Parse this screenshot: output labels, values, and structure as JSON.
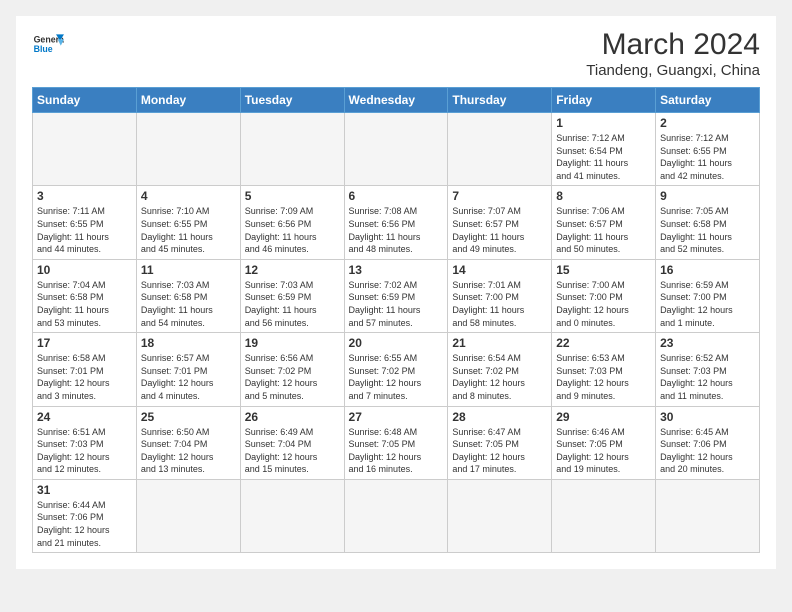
{
  "header": {
    "logo_general": "General",
    "logo_blue": "Blue",
    "month_year": "March 2024",
    "location": "Tiandeng, Guangxi, China"
  },
  "days_of_week": [
    "Sunday",
    "Monday",
    "Tuesday",
    "Wednesday",
    "Thursday",
    "Friday",
    "Saturday"
  ],
  "weeks": [
    [
      {
        "day": "",
        "info": ""
      },
      {
        "day": "",
        "info": ""
      },
      {
        "day": "",
        "info": ""
      },
      {
        "day": "",
        "info": ""
      },
      {
        "day": "",
        "info": ""
      },
      {
        "day": "1",
        "info": "Sunrise: 7:12 AM\nSunset: 6:54 PM\nDaylight: 11 hours\nand 41 minutes."
      },
      {
        "day": "2",
        "info": "Sunrise: 7:12 AM\nSunset: 6:55 PM\nDaylight: 11 hours\nand 42 minutes."
      }
    ],
    [
      {
        "day": "3",
        "info": "Sunrise: 7:11 AM\nSunset: 6:55 PM\nDaylight: 11 hours\nand 44 minutes."
      },
      {
        "day": "4",
        "info": "Sunrise: 7:10 AM\nSunset: 6:55 PM\nDaylight: 11 hours\nand 45 minutes."
      },
      {
        "day": "5",
        "info": "Sunrise: 7:09 AM\nSunset: 6:56 PM\nDaylight: 11 hours\nand 46 minutes."
      },
      {
        "day": "6",
        "info": "Sunrise: 7:08 AM\nSunset: 6:56 PM\nDaylight: 11 hours\nand 48 minutes."
      },
      {
        "day": "7",
        "info": "Sunrise: 7:07 AM\nSunset: 6:57 PM\nDaylight: 11 hours\nand 49 minutes."
      },
      {
        "day": "8",
        "info": "Sunrise: 7:06 AM\nSunset: 6:57 PM\nDaylight: 11 hours\nand 50 minutes."
      },
      {
        "day": "9",
        "info": "Sunrise: 7:05 AM\nSunset: 6:58 PM\nDaylight: 11 hours\nand 52 minutes."
      }
    ],
    [
      {
        "day": "10",
        "info": "Sunrise: 7:04 AM\nSunset: 6:58 PM\nDaylight: 11 hours\nand 53 minutes."
      },
      {
        "day": "11",
        "info": "Sunrise: 7:03 AM\nSunset: 6:58 PM\nDaylight: 11 hours\nand 54 minutes."
      },
      {
        "day": "12",
        "info": "Sunrise: 7:03 AM\nSunset: 6:59 PM\nDaylight: 11 hours\nand 56 minutes."
      },
      {
        "day": "13",
        "info": "Sunrise: 7:02 AM\nSunset: 6:59 PM\nDaylight: 11 hours\nand 57 minutes."
      },
      {
        "day": "14",
        "info": "Sunrise: 7:01 AM\nSunset: 7:00 PM\nDaylight: 11 hours\nand 58 minutes."
      },
      {
        "day": "15",
        "info": "Sunrise: 7:00 AM\nSunset: 7:00 PM\nDaylight: 12 hours\nand 0 minutes."
      },
      {
        "day": "16",
        "info": "Sunrise: 6:59 AM\nSunset: 7:00 PM\nDaylight: 12 hours\nand 1 minute."
      }
    ],
    [
      {
        "day": "17",
        "info": "Sunrise: 6:58 AM\nSunset: 7:01 PM\nDaylight: 12 hours\nand 3 minutes."
      },
      {
        "day": "18",
        "info": "Sunrise: 6:57 AM\nSunset: 7:01 PM\nDaylight: 12 hours\nand 4 minutes."
      },
      {
        "day": "19",
        "info": "Sunrise: 6:56 AM\nSunset: 7:02 PM\nDaylight: 12 hours\nand 5 minutes."
      },
      {
        "day": "20",
        "info": "Sunrise: 6:55 AM\nSunset: 7:02 PM\nDaylight: 12 hours\nand 7 minutes."
      },
      {
        "day": "21",
        "info": "Sunrise: 6:54 AM\nSunset: 7:02 PM\nDaylight: 12 hours\nand 8 minutes."
      },
      {
        "day": "22",
        "info": "Sunrise: 6:53 AM\nSunset: 7:03 PM\nDaylight: 12 hours\nand 9 minutes."
      },
      {
        "day": "23",
        "info": "Sunrise: 6:52 AM\nSunset: 7:03 PM\nDaylight: 12 hours\nand 11 minutes."
      }
    ],
    [
      {
        "day": "24",
        "info": "Sunrise: 6:51 AM\nSunset: 7:03 PM\nDaylight: 12 hours\nand 12 minutes."
      },
      {
        "day": "25",
        "info": "Sunrise: 6:50 AM\nSunset: 7:04 PM\nDaylight: 12 hours\nand 13 minutes."
      },
      {
        "day": "26",
        "info": "Sunrise: 6:49 AM\nSunset: 7:04 PM\nDaylight: 12 hours\nand 15 minutes."
      },
      {
        "day": "27",
        "info": "Sunrise: 6:48 AM\nSunset: 7:05 PM\nDaylight: 12 hours\nand 16 minutes."
      },
      {
        "day": "28",
        "info": "Sunrise: 6:47 AM\nSunset: 7:05 PM\nDaylight: 12 hours\nand 17 minutes."
      },
      {
        "day": "29",
        "info": "Sunrise: 6:46 AM\nSunset: 7:05 PM\nDaylight: 12 hours\nand 19 minutes."
      },
      {
        "day": "30",
        "info": "Sunrise: 6:45 AM\nSunset: 7:06 PM\nDaylight: 12 hours\nand 20 minutes."
      }
    ],
    [
      {
        "day": "31",
        "info": "Sunrise: 6:44 AM\nSunset: 7:06 PM\nDaylight: 12 hours\nand 21 minutes."
      },
      {
        "day": "",
        "info": ""
      },
      {
        "day": "",
        "info": ""
      },
      {
        "day": "",
        "info": ""
      },
      {
        "day": "",
        "info": ""
      },
      {
        "day": "",
        "info": ""
      },
      {
        "day": "",
        "info": ""
      }
    ]
  ]
}
